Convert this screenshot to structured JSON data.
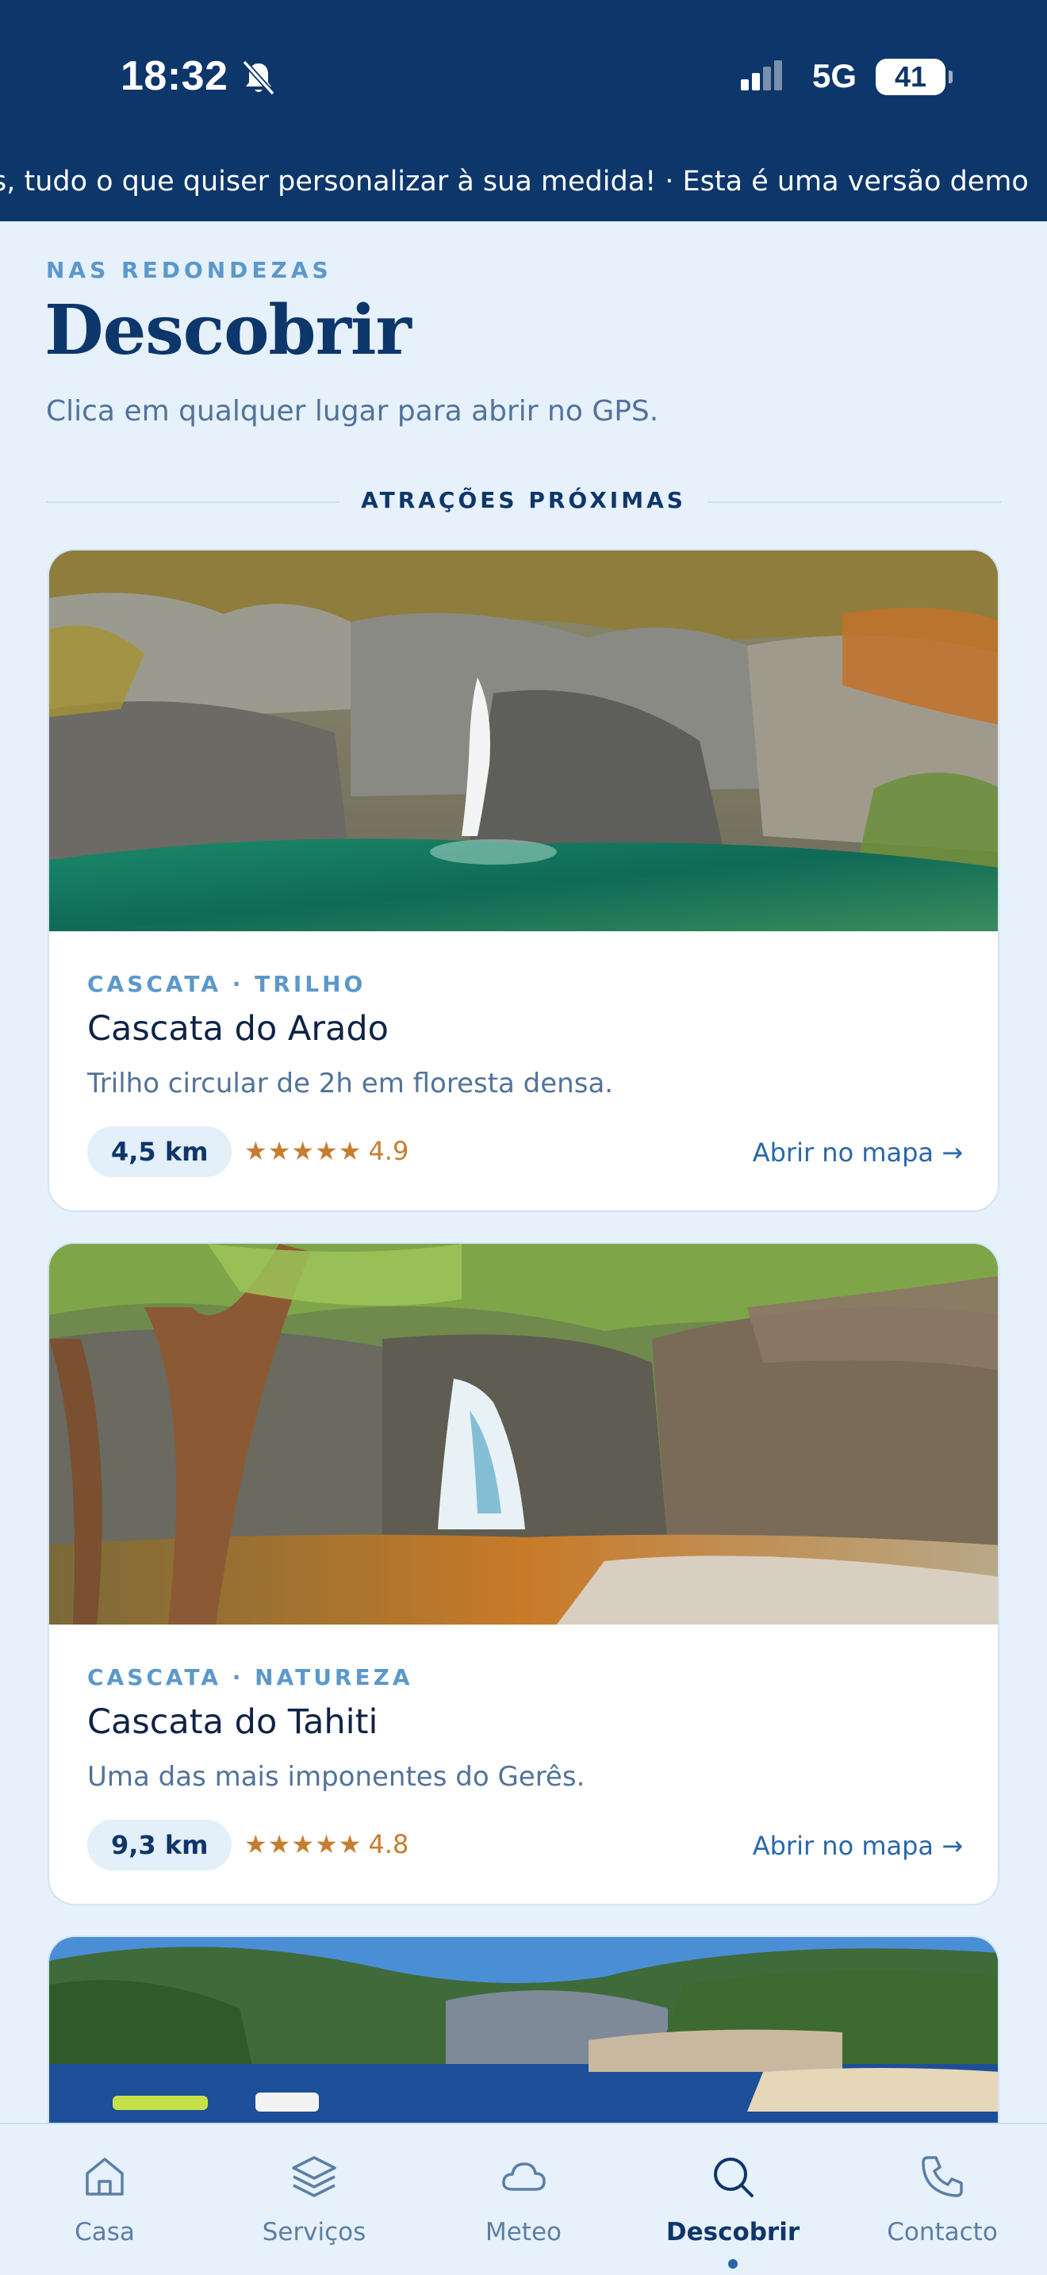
{
  "status_bar": {
    "time": "18:32",
    "network": "5G",
    "battery": "41"
  },
  "banner": {
    "text": "s, tudo o que quiser personalizar à sua medida! · Esta é uma versão demo"
  },
  "header": {
    "eyebrow": "NAS REDONDEZAS",
    "title": "Descobrir",
    "subtitle": "Clica em qualquer lugar para abrir no GPS.",
    "section_label": "ATRAÇÕES PRÓXIMAS"
  },
  "cards": [
    {
      "category": "CASCATA · TRILHO",
      "title": "Cascata do Arado",
      "description": "Trilho circular de 2h em floresta densa.",
      "distance": "4,5 km",
      "stars": "★★★★★",
      "rating": "4.9",
      "map_link": "Abrir no mapa →"
    },
    {
      "category": "CASCATA · NATUREZA",
      "title": "Cascata do Tahiti",
      "description": "Uma das mais imponentes do Gerês.",
      "distance": "9,3 km",
      "stars": "★★★★★",
      "rating": "4.8",
      "map_link": "Abrir no mapa →"
    }
  ],
  "bottom_nav": {
    "items": [
      {
        "label": "Casa",
        "icon": "home-icon"
      },
      {
        "label": "Serviços",
        "icon": "layers-icon"
      },
      {
        "label": "Meteo",
        "icon": "cloud-icon"
      },
      {
        "label": "Descobrir",
        "icon": "search-icon",
        "active": true
      },
      {
        "label": "Contacto",
        "icon": "phone-icon"
      }
    ]
  },
  "colors": {
    "header_bg": "#0d366b",
    "page_bg": "#e6f1fb",
    "accent": "#5b98cc",
    "star": "#c77d30",
    "link": "#2a67a8"
  }
}
